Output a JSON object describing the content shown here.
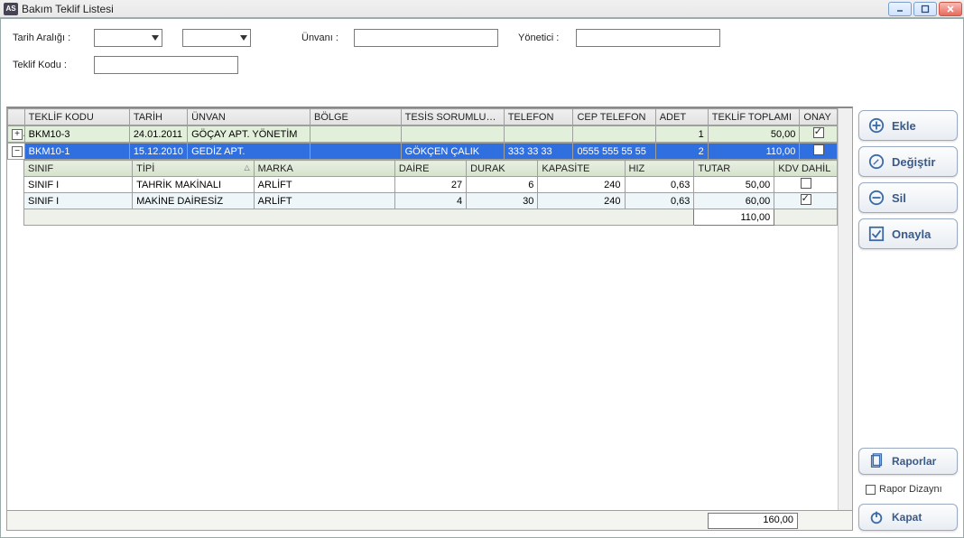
{
  "window": {
    "title": "Bakım Teklif Listesi",
    "icon_text": "AS"
  },
  "filters": {
    "date_range_label": "Tarih Aralığı :",
    "unvan_label": "Ünvanı :",
    "yonetici_label": "Yönetici :",
    "teklif_kodu_label": "Teklif Kodu :",
    "date_from": "",
    "date_to": "",
    "unvan": "",
    "yonetici": "",
    "teklif_kodu": ""
  },
  "grid": {
    "headers": {
      "teklif_kodu": "TEKLİF KODU",
      "tarih": "TARİH",
      "unvan": "ÜNVAN",
      "bolge": "BÖLGE",
      "tesis_sorumlusu": "TESİS SORUMLUSU",
      "telefon": "TELEFON",
      "cep_telefon": "CEP TELEFON",
      "adet": "ADET",
      "teklif_toplami": "TEKLİF TOPLAMI",
      "onay": "ONAY"
    },
    "rows": [
      {
        "expanded": false,
        "teklif_kodu": "BKM10-3",
        "tarih": "24.01.2011",
        "unvan": "GÖÇAY APT. YÖNETİM",
        "bolge": "",
        "tesis_sorumlusu": "",
        "telefon": "",
        "cep_telefon": "",
        "adet": "1",
        "teklif_toplami": "50,00",
        "onay": true,
        "selected": false
      },
      {
        "expanded": true,
        "teklif_kodu": "BKM10-1",
        "tarih": "15.12.2010",
        "unvan": "GEDİZ APT.",
        "bolge": "",
        "tesis_sorumlusu": "GÖKÇEN ÇALIK",
        "telefon": "333 33 33",
        "cep_telefon": "0555 555 55 55",
        "adet": "2",
        "teklif_toplami": "110,00",
        "onay": false,
        "selected": true
      }
    ],
    "grand_total": "160,00"
  },
  "inner": {
    "headers": {
      "sinif": "SINIF",
      "tipi": "TİPİ",
      "marka": "MARKA",
      "daire": "DAİRE",
      "durak": "DURAK",
      "kapasite": "KAPASİTE",
      "hiz": "HIZ",
      "tutar": "TUTAR",
      "kdv": "KDV DAHİL"
    },
    "rows": [
      {
        "sinif": "SINIF I",
        "tipi": "TAHRİK MAKİNALI",
        "marka": "ARLİFT",
        "daire": "27",
        "durak": "6",
        "kapasite": "240",
        "hiz": "0,63",
        "tutar": "50,00",
        "kdv": false
      },
      {
        "sinif": "SINIF I",
        "tipi": "MAKİNE DAİRESİZ",
        "marka": "ARLİFT",
        "daire": "4",
        "durak": "30",
        "kapasite": "240",
        "hiz": "0,63",
        "tutar": "60,00",
        "kdv": true
      }
    ],
    "subtotal": "110,00"
  },
  "buttons": {
    "ekle": "Ekle",
    "degistir": "Değiştir",
    "sil": "Sil",
    "onayla": "Onayla",
    "raporlar": "Raporlar",
    "kapat": "Kapat",
    "rapor_dizayni": "Rapor Dizaynı"
  }
}
